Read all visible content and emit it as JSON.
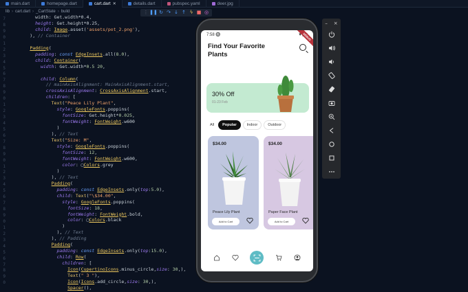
{
  "editor": {
    "tabs": [
      {
        "label": "main.dart",
        "active": false
      },
      {
        "label": "homepage.dart",
        "active": false
      },
      {
        "label": "cart.dart",
        "active": true
      },
      {
        "label": "details.dart",
        "active": false
      },
      {
        "label": "pubspec.yaml",
        "active": false
      },
      {
        "label": "deer.jpg",
        "active": false
      }
    ],
    "breadcrumb": [
      "lib",
      "cart.dart",
      "_CartState",
      "build"
    ],
    "debug_toolbar": [
      "drag-handle-icon",
      "pause-icon",
      "restart-icon",
      "step-over-icon",
      "step-into-icon",
      "step-out-icon",
      "hot-reload-icon",
      "stop-icon",
      "devtools-icon"
    ]
  },
  "phone": {
    "status_time": "7:58 🔘",
    "status_icons": "▼◢▮",
    "debug_ribbon": "DEBUG",
    "title": "Find Your Favorite Plants",
    "promo": {
      "title": "30% Off",
      "dates": "01-23 Feb"
    },
    "categories": [
      {
        "label": "All",
        "selected": false
      },
      {
        "label": "Popular",
        "selected": true
      },
      {
        "label": "Indoor",
        "selected": false
      },
      {
        "label": "Outdoor",
        "selected": false
      }
    ],
    "products": [
      {
        "price": "$34.00",
        "name": "Peace Lily Plant",
        "button": "Add to Cart",
        "bg": "#bfc6df"
      },
      {
        "price": "$34.00",
        "name": "Paper Face Plant",
        "button": "Add to Cart",
        "bg": "#d7c8e2"
      }
    ],
    "accent": "#5fbcc5",
    "promo_bg": "#c3ead1"
  },
  "emulator_toolbar": {
    "window_controls": [
      "–",
      "×"
    ],
    "buttons": [
      "power-icon",
      "volume-up-icon",
      "volume-down-icon",
      "rotate-left-icon",
      "rotate-right-icon",
      "camera-icon",
      "zoom-icon",
      "back-icon",
      "home-icon",
      "overview-icon",
      "more-icon"
    ]
  }
}
